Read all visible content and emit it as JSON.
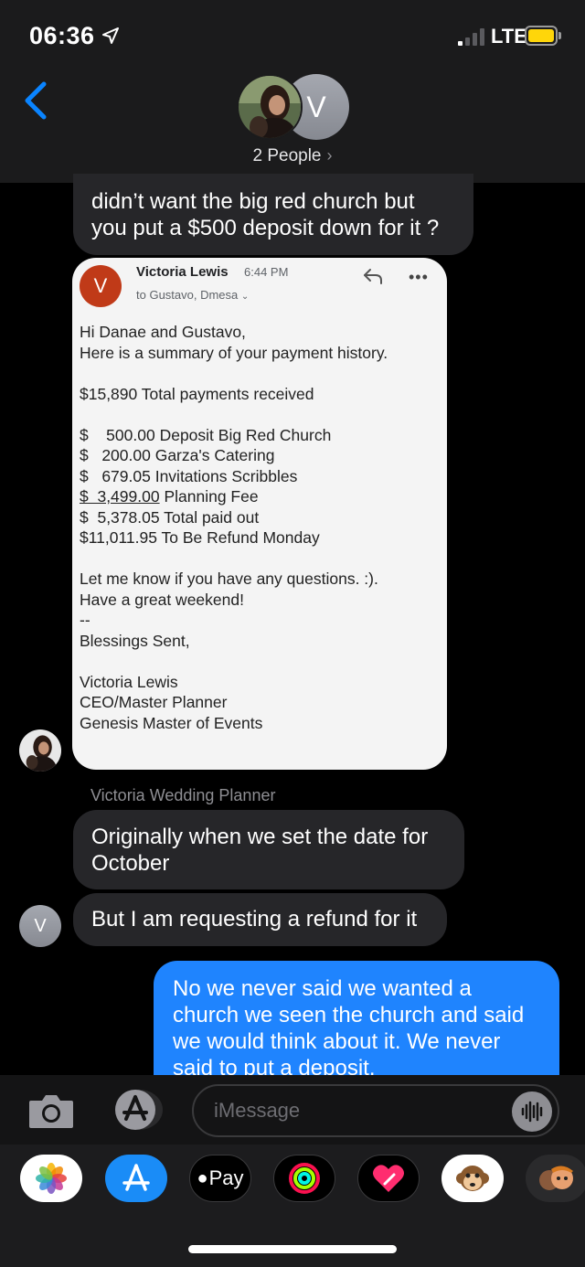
{
  "status_bar": {
    "time": "06:36",
    "network": "LTE"
  },
  "header": {
    "participants_label": "2 People",
    "avatar_initial": "V"
  },
  "messages": {
    "msg1": {
      "lines": [
        "didn’t want the big red church but",
        "you put a $500 deposit down for it ?"
      ]
    },
    "email": {
      "avatar_initial": "V",
      "sender": "Victoria Lewis",
      "time": "6:44 PM",
      "to": "to Gustavo, Dmesa",
      "lines": [
        "Hi Danae and Gustavo,",
        "",
        "Here is a summary of your payment history.",
        "",
        "$15,890 Total payments received",
        "",
        "$    500.00 Deposit Big Red Church",
        "$   200.00 Garza's Catering",
        "$   679.05 Invitations Scribbles",
        "$  3,499.00",
        "$  5,378.05 Total paid out",
        "$11,011.95 To Be Refund Monday",
        "",
        "Let me know if you have any questions. :).",
        "Have a great weekend!",
        "--",
        "Blessings Sent,",
        "",
        "Victoria Lewis",
        "CEO/Master Planner",
        "Genesis Master of Events"
      ],
      "planning_fee_label": " Planning Fee"
    },
    "sender_name": "Victoria Wedding Planner",
    "msg2": {
      "lines": [
        "Originally when we set the date for",
        "October"
      ]
    },
    "msg3": {
      "text": "But I am requesting a refund for it"
    },
    "sender_avatar_initial": "V",
    "outgoing": {
      "lines": [
        "No we never said we wanted a",
        "church we seen the church and said",
        "we would think about it. We never",
        "said to put a deposit."
      ]
    }
  },
  "input": {
    "placeholder": "iMessage"
  },
  "app_drawer": {
    "apps": [
      "photos-icon",
      "app-store-icon",
      "apple-pay-icon",
      "activity-icon",
      "digital-touch-icon",
      "animoji-icon",
      "memoji-icon"
    ],
    "apple_pay_label": "Pay"
  },
  "colors": {
    "accent": "#0A84FF",
    "outgoing_bubble": "#1F84FE",
    "incoming_bubble": "#262629",
    "battery": "#FFD60A",
    "email_avatar": "#C03A18"
  }
}
